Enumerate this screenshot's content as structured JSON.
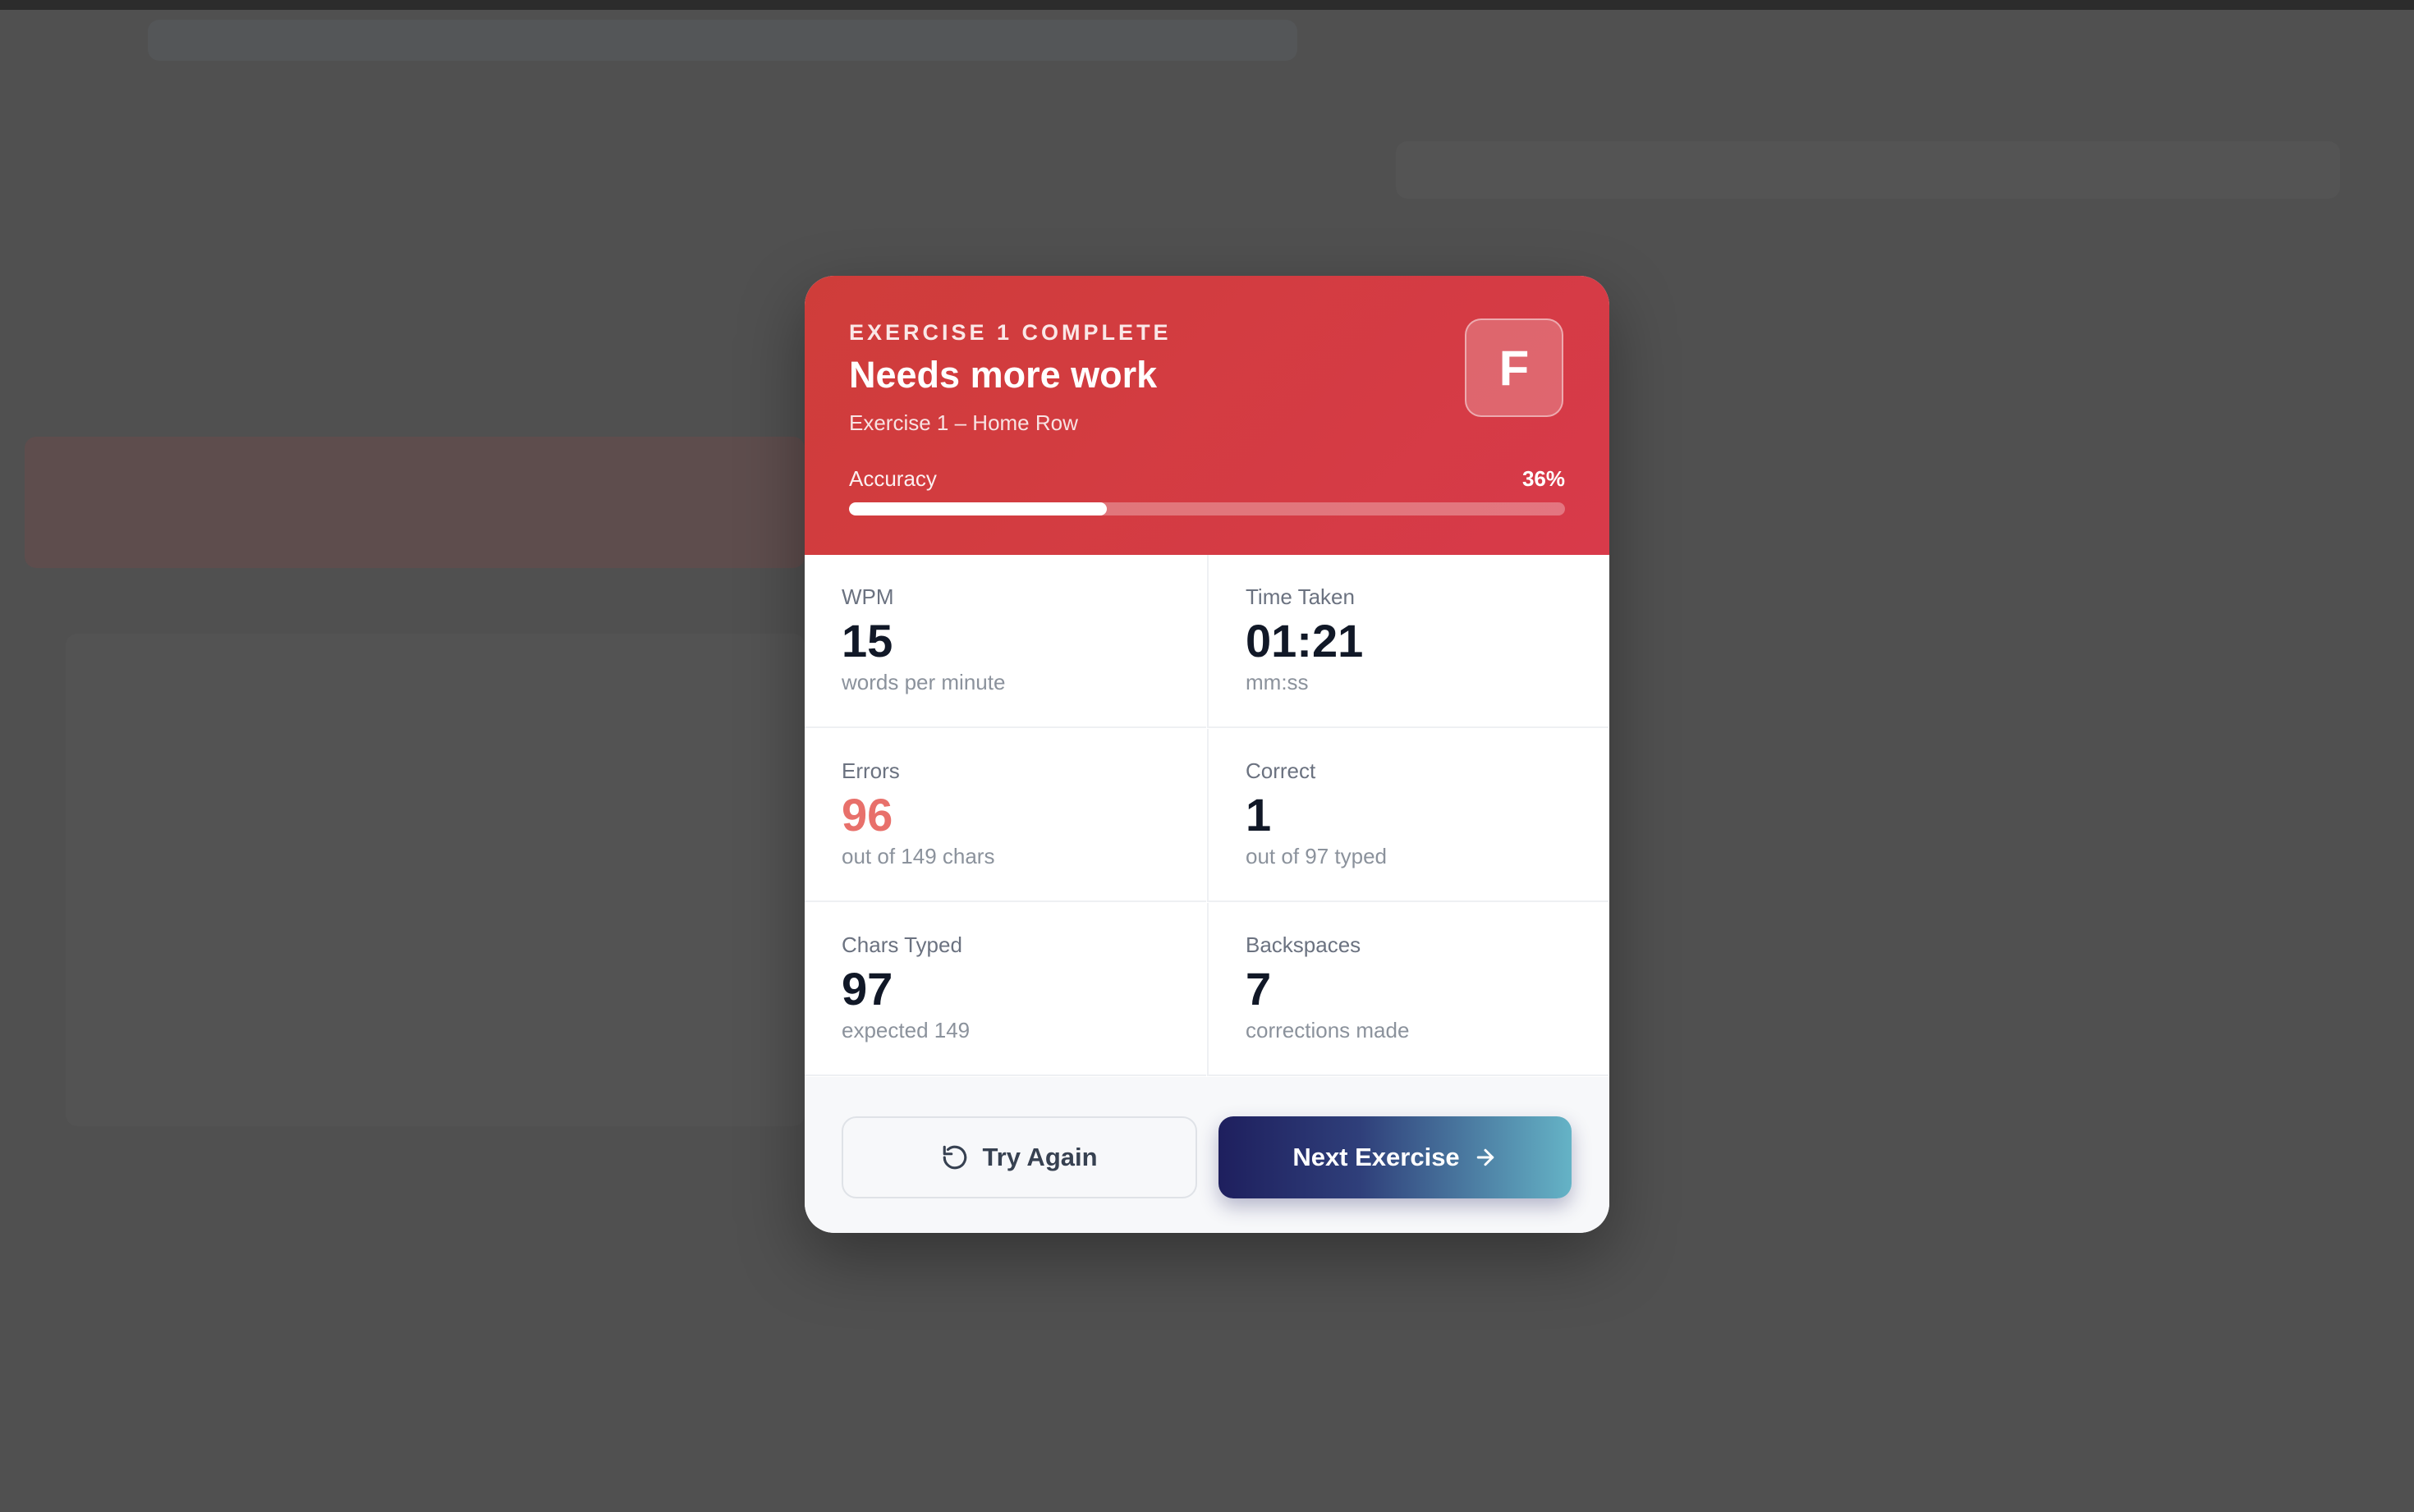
{
  "result": {
    "eyebrow": "EXERCISE 1 COMPLETE",
    "title": "Needs more work",
    "subtitle": "Exercise 1 – Home Row",
    "grade": "F",
    "accuracy_label": "Accuracy",
    "accuracy_value": "36%",
    "accuracy_fraction": 0.36,
    "header_color": "#d83a4a"
  },
  "stats": {
    "wpm": {
      "label": "WPM",
      "value": "15",
      "sub": "words per minute"
    },
    "time": {
      "label": "Time Taken",
      "value": "01:21",
      "sub": "mm:ss"
    },
    "errors": {
      "label": "Errors",
      "value": "96",
      "sub": "out of 149 chars"
    },
    "correct": {
      "label": "Correct",
      "value": "1",
      "sub": "out of 97 typed"
    },
    "chars": {
      "label": "Chars Typed",
      "value": "97",
      "sub": "expected 149"
    },
    "backspaces": {
      "label": "Backspaces",
      "value": "7",
      "sub": "corrections made"
    }
  },
  "actions": {
    "retry_label": "Try Again",
    "retry_icon": "rotate-ccw-icon",
    "next_label": "Next Exercise",
    "next_icon": "arrow-right-icon"
  }
}
